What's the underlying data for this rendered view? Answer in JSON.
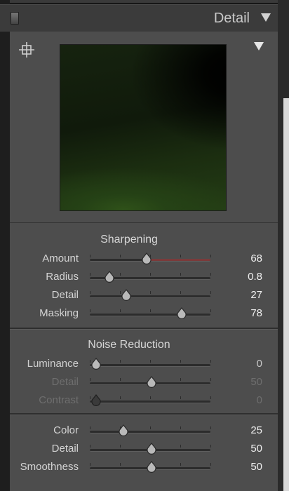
{
  "panel": {
    "title": "Detail",
    "colors": {
      "panel_bg": "#4d4d4d",
      "text": "#d4d4d4",
      "dim_text": "#6e6e6e",
      "amount_tint": "#7b3b3b"
    }
  },
  "icons": {
    "toggle": "panel-toggle-icon",
    "collapse": "triangle-down-icon",
    "target": "crosshair-target-icon"
  },
  "sharpening": {
    "title": "Sharpening",
    "sliders": [
      {
        "label": "Amount",
        "value": "68",
        "position": 0.47,
        "tint_from": 0.47,
        "tint_to": 1.0
      },
      {
        "label": "Radius",
        "value": "0.8",
        "position": 0.16
      },
      {
        "label": "Detail",
        "value": "27",
        "position": 0.3
      },
      {
        "label": "Masking",
        "value": "78",
        "position": 0.76
      }
    ]
  },
  "noise_reduction": {
    "title": "Noise Reduction",
    "luminance": [
      {
        "label": "Luminance",
        "value": "0",
        "position": 0.05,
        "state": "mid"
      },
      {
        "label": "Detail",
        "value": "50",
        "position": 0.51,
        "state": "dim"
      },
      {
        "label": "Contrast",
        "value": "0",
        "position": 0.05,
        "state": "dim"
      }
    ],
    "color": [
      {
        "label": "Color",
        "value": "25",
        "position": 0.28
      },
      {
        "label": "Detail",
        "value": "50",
        "position": 0.51
      },
      {
        "label": "Smoothness",
        "value": "50",
        "position": 0.51
      }
    ]
  }
}
